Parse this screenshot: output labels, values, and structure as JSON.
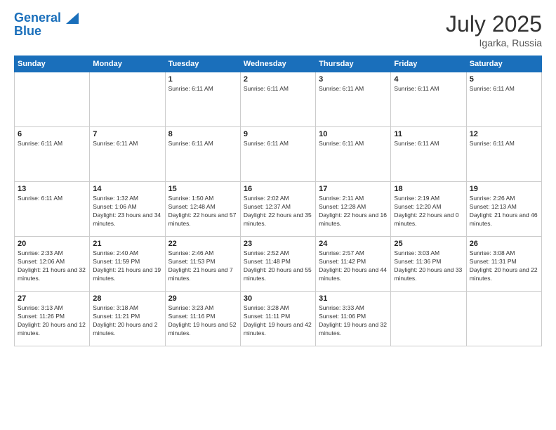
{
  "logo": {
    "line1": "General",
    "line2": "Blue"
  },
  "title": "July 2025",
  "location": "Igarka, Russia",
  "header_days": [
    "Sunday",
    "Monday",
    "Tuesday",
    "Wednesday",
    "Thursday",
    "Friday",
    "Saturday"
  ],
  "weeks": [
    [
      {
        "day": "",
        "info": ""
      },
      {
        "day": "",
        "info": ""
      },
      {
        "day": "1",
        "info": "Sunrise: 6:11 AM"
      },
      {
        "day": "2",
        "info": "Sunrise: 6:11 AM"
      },
      {
        "day": "3",
        "info": "Sunrise: 6:11 AM"
      },
      {
        "day": "4",
        "info": "Sunrise: 6:11 AM"
      },
      {
        "day": "5",
        "info": "Sunrise: 6:11 AM"
      }
    ],
    [
      {
        "day": "6",
        "info": "Sunrise: 6:11 AM"
      },
      {
        "day": "7",
        "info": "Sunrise: 6:11 AM"
      },
      {
        "day": "8",
        "info": "Sunrise: 6:11 AM"
      },
      {
        "day": "9",
        "info": "Sunrise: 6:11 AM"
      },
      {
        "day": "10",
        "info": "Sunrise: 6:11 AM"
      },
      {
        "day": "11",
        "info": "Sunrise: 6:11 AM"
      },
      {
        "day": "12",
        "info": "Sunrise: 6:11 AM"
      }
    ],
    [
      {
        "day": "13",
        "info": "Sunrise: 6:11 AM"
      },
      {
        "day": "14",
        "info": "Sunrise: 1:32 AM\nSunset: 1:06 AM\nDaylight: 23 hours and 34 minutes."
      },
      {
        "day": "15",
        "info": "Sunrise: 1:50 AM\nSunset: 12:48 AM\nDaylight: 22 hours and 57 minutes."
      },
      {
        "day": "16",
        "info": "Sunrise: 2:02 AM\nSunset: 12:37 AM\nDaylight: 22 hours and 35 minutes."
      },
      {
        "day": "17",
        "info": "Sunrise: 2:11 AM\nSunset: 12:28 AM\nDaylight: 22 hours and 16 minutes."
      },
      {
        "day": "18",
        "info": "Sunrise: 2:19 AM\nSunset: 12:20 AM\nDaylight: 22 hours and 0 minutes."
      },
      {
        "day": "19",
        "info": "Sunrise: 2:26 AM\nSunset: 12:13 AM\nDaylight: 21 hours and 46 minutes."
      }
    ],
    [
      {
        "day": "20",
        "info": "Sunrise: 2:33 AM\nSunset: 12:06 AM\nDaylight: 21 hours and 32 minutes."
      },
      {
        "day": "21",
        "info": "Sunrise: 2:40 AM\nSunset: 11:59 PM\nDaylight: 21 hours and 19 minutes."
      },
      {
        "day": "22",
        "info": "Sunrise: 2:46 AM\nSunset: 11:53 PM\nDaylight: 21 hours and 7 minutes."
      },
      {
        "day": "23",
        "info": "Sunrise: 2:52 AM\nSunset: 11:48 PM\nDaylight: 20 hours and 55 minutes."
      },
      {
        "day": "24",
        "info": "Sunrise: 2:57 AM\nSunset: 11:42 PM\nDaylight: 20 hours and 44 minutes."
      },
      {
        "day": "25",
        "info": "Sunrise: 3:03 AM\nSunset: 11:36 PM\nDaylight: 20 hours and 33 minutes."
      },
      {
        "day": "26",
        "info": "Sunrise: 3:08 AM\nSunset: 11:31 PM\nDaylight: 20 hours and 22 minutes."
      }
    ],
    [
      {
        "day": "27",
        "info": "Sunrise: 3:13 AM\nSunset: 11:26 PM\nDaylight: 20 hours and 12 minutes."
      },
      {
        "day": "28",
        "info": "Sunrise: 3:18 AM\nSunset: 11:21 PM\nDaylight: 20 hours and 2 minutes."
      },
      {
        "day": "29",
        "info": "Sunrise: 3:23 AM\nSunset: 11:16 PM\nDaylight: 19 hours and 52 minutes."
      },
      {
        "day": "30",
        "info": "Sunrise: 3:28 AM\nSunset: 11:11 PM\nDaylight: 19 hours and 42 minutes."
      },
      {
        "day": "31",
        "info": "Sunrise: 3:33 AM\nSunset: 11:06 PM\nDaylight: 19 hours and 32 minutes."
      },
      {
        "day": "",
        "info": ""
      },
      {
        "day": "",
        "info": ""
      }
    ]
  ]
}
